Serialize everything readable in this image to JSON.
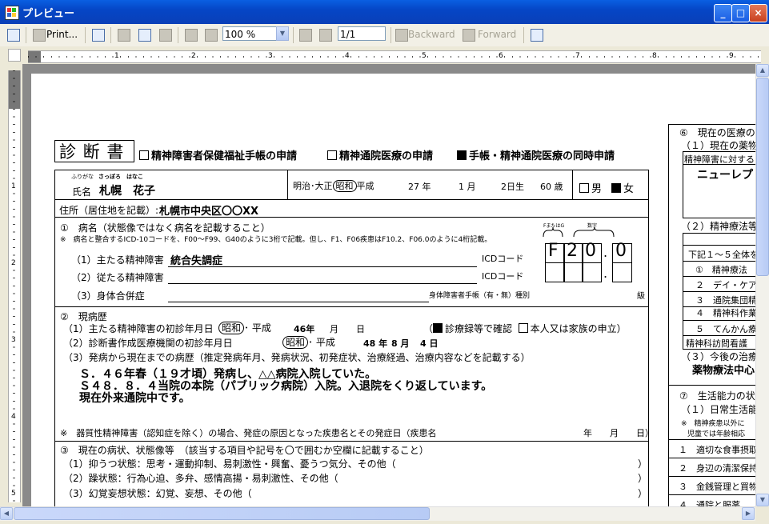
{
  "window": {
    "title": "プレビュー",
    "minimize": "_",
    "maximize": "□",
    "close": "×"
  },
  "toolbar": {
    "print_label": "Print...",
    "zoom_value": "100 %",
    "page_value": "1/1",
    "backward_label": "Backward",
    "forward_label": "Forward"
  },
  "ruler_numbers": [
    "1",
    "2",
    "3",
    "4",
    "5",
    "6",
    "7",
    "8",
    "9"
  ],
  "doc": {
    "title": "診 断 書",
    "opt1": "精神障害者保健福祉手帳の申請",
    "opt2": "精神通院医療の申請",
    "opt3": "手帳・精神通院医療の同時申請",
    "furigana_label": "ふりがな",
    "furigana_value": "さっぽろ　はなこ",
    "name_label": "氏名",
    "name_value": "札幌　花子",
    "era_pre": "明治･大正",
    "era_showa": "昭和",
    "era_post": "平成",
    "birth_year": "27 年",
    "birth_month": "1 月",
    "birth_day": "2日生",
    "age": "60 歳",
    "sex_male": "男",
    "sex_female": "女",
    "address_label": "住所（居住地を記載）:",
    "address_value": "札幌市中央区〇〇XX",
    "s1_title": "①　病名（状態像ではなく病名を記載すること）",
    "s1_note": "※　病名と整合するICD-10コードを、F00～F99、G40のように3桁で記載。但し、F1、F06疾患はF10.2、F06.0のように4桁記載。",
    "code_label_a": "FまたはG",
    "code_label_b": "数字",
    "r1_label": "（1）主たる精神障害",
    "r1_value": "統合失調症",
    "r2_label": "（2）従たる精神障害",
    "r3_label": "（3）身体合併症",
    "icd_label": "ICDコード",
    "icd_chars": [
      "F",
      "2",
      "0",
      ".",
      "0"
    ],
    "shintai_label": "身体障害者手帳（有・無）種別",
    "kyu": "級",
    "s2_title": "②　現病歴",
    "s2_l1_label": "（1）主たる精神障害の初診年月日",
    "s2_l1_showa": "昭和",
    "s2_l1_post": "･ 平成",
    "s2_l1_year": "46年",
    "s2_l1_month": "月",
    "s2_l1_day": "日",
    "s2_l1_check": "診療録等で確認",
    "s2_l1_check2": "本人又は家族の申立）",
    "s2_l1_paren": "（",
    "s2_l2_label": "（2）診断書作成医療機関の初診年月日",
    "s2_l2_showa": "昭和",
    "s2_l2_post": "･ 平成",
    "s2_l2_year": "48 年",
    "s2_l2_month": "8 月",
    "s2_l2_day": "4 日",
    "s2_l3_label": "（3）発病から現在までの病歴（推定発病年月、発病状況、初発症状、治療経過、治療内容などを記載する）",
    "history_1": "Ｓ．４６年春（１９才頃）発病し、△△病院入院していた。",
    "history_2": "Ｓ４８．８．４当院の本院（パブリック病院）入院。入退院をくり返しています。",
    "history_3": "現在外来通院中です。",
    "s2_note": "※　器質性精神障害（認知症を除く）の場合、発症の原因となった疾患名とその発症日（疾患名",
    "s2_note_date": "年　　月　　日）",
    "s3_title": "③　現在の病状、状態像等　（該当する項目や記号を〇で囲むか空欄に記載すること）",
    "s3_items": [
      "（1）抑うつ状態：思考・運動抑制、易刺激性・興奮、憂うつ気分、その他（",
      "（2）躁状態：行為心迫、多弁、感情高揚・易刺激性、その他（",
      "（3）幻覚妄想状態：幻覚、妄想、その他（"
    ],
    "close_paren": "）",
    "right": {
      "s6_title": "⑥　現在の医療の",
      "s6_sub": "（１）現在の薬物",
      "s6_box_head": "精神障害に対する",
      "s6_drug": "ニューレプ",
      "s6_sub2": "（２）精神療法等",
      "s6_list_head": "下記１～５全体を",
      "s6_items": [
        "①　精神療法",
        "２　デイ・ケア",
        "３　通院集団精",
        "４　精神科作業",
        "５　てんかん療",
        "精神科訪問看護"
      ],
      "s6_sub3": "（３）今後の治療",
      "s6_plan": "薬物療法中心",
      "s7_title": "⑦　生活能力の状",
      "s7_sub": "（１）日常生活能",
      "s7_note1": "※　精神疾患以外に",
      "s7_note2": "児童では年齢相応",
      "s7_items": [
        "１　適切な食事摂取",
        "２　身辺の清潔保持",
        "３　金銭管理と買物",
        "４　通院と服薬"
      ]
    }
  }
}
